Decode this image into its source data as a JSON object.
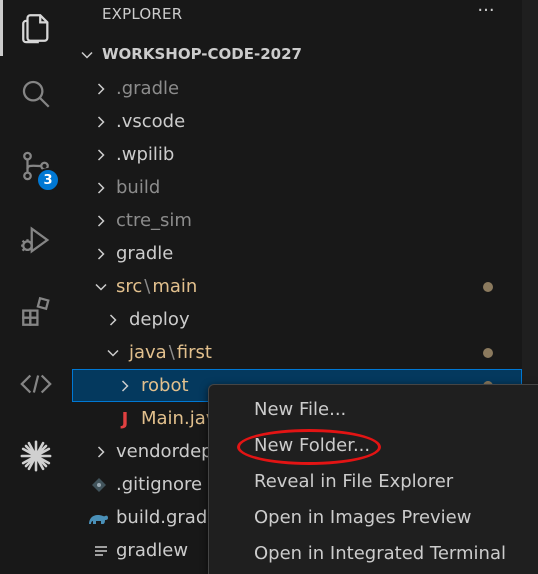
{
  "activity_bar": {
    "items": [
      {
        "name": "explorer",
        "icon": "files-icon",
        "active": true
      },
      {
        "name": "search",
        "icon": "search-icon"
      },
      {
        "name": "source-control",
        "icon": "source-control-icon",
        "badge": "3"
      },
      {
        "name": "run-debug",
        "icon": "run-debug-icon"
      },
      {
        "name": "extensions",
        "icon": "extensions-icon"
      },
      {
        "name": "remote",
        "icon": "remote-explorer-icon"
      },
      {
        "name": "wpilib",
        "icon": "wpilib-icon"
      }
    ]
  },
  "sidebar": {
    "title": "EXPLORER",
    "more_actions": "···",
    "section_title": "WORKSHOP-CODE-2027",
    "tree": {
      "gradle_dir": ".gradle",
      "vscode_dir": ".vscode",
      "wpilib_dir": ".wpilib",
      "build_dir": "build",
      "ctre_sim_dir": "ctre_sim",
      "gradle_folder": "gradle",
      "src": "src",
      "src_sep": "\\",
      "main": "main",
      "deploy": "deploy",
      "java": "java",
      "java_sep": "\\",
      "first": "first",
      "robot": "robot",
      "main_java": "Main.java",
      "main_java_icon": "J",
      "vendordeps": "vendordeps",
      "gitignore": ".gitignore",
      "build_gradle": "build.gradle",
      "gradlew": "gradlew"
    }
  },
  "context_menu": {
    "items": [
      "New File...",
      "New Folder...",
      "Reveal in File Explorer",
      "Open in Images Preview",
      "Open in Integrated Terminal"
    ]
  },
  "colors": {
    "accent": "#0078d4",
    "modified_text": "#e2c08d",
    "highlight_ellipse": "#e31414",
    "java_icon": "#e04040"
  }
}
